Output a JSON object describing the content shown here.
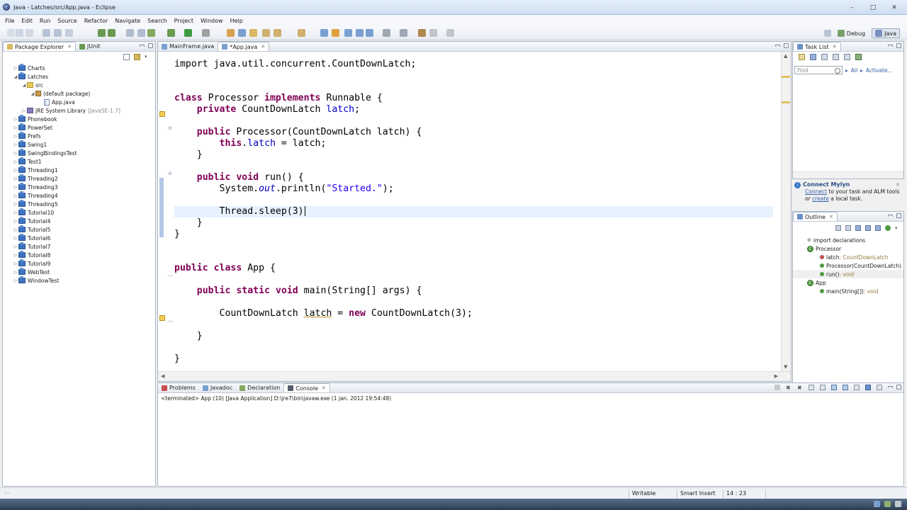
{
  "window": {
    "title": "Java - Latches/src/App.java - Eclipse"
  },
  "menu": [
    "File",
    "Edit",
    "Run",
    "Source",
    "Refactor",
    "Navigate",
    "Search",
    "Project",
    "Window",
    "Help"
  ],
  "perspectives": [
    {
      "label": "Debug",
      "active": false
    },
    {
      "label": "Java",
      "active": true
    }
  ],
  "package_explorer": {
    "tabs": [
      {
        "label": "Package Explorer",
        "active": true
      },
      {
        "label": "JUnit",
        "active": false
      }
    ],
    "rows": [
      {
        "label": "Charts",
        "indent": 0,
        "type": "project",
        "expanded": false
      },
      {
        "label": "Latches",
        "indent": 0,
        "type": "project",
        "expanded": true
      },
      {
        "label": "src",
        "indent": 1,
        "type": "src",
        "expanded": true
      },
      {
        "label": "(default package)",
        "indent": 2,
        "type": "package",
        "expanded": true
      },
      {
        "label": "App.java",
        "indent": 3,
        "type": "file",
        "expanded": null
      },
      {
        "label": "JRE System Library",
        "extra": "[JavaSE-1.7]",
        "indent": 1,
        "type": "lib",
        "expanded": false
      },
      {
        "label": "Phonebook",
        "indent": 0,
        "type": "project",
        "expanded": false
      },
      {
        "label": "PowerSet",
        "indent": 0,
        "type": "project",
        "expanded": false
      },
      {
        "label": "Prefs",
        "indent": 0,
        "type": "project",
        "expanded": false
      },
      {
        "label": "Swing1",
        "indent": 0,
        "type": "project",
        "expanded": false
      },
      {
        "label": "SwingBindingsTest",
        "indent": 0,
        "type": "project",
        "expanded": false
      },
      {
        "label": "Test1",
        "indent": 0,
        "type": "project",
        "expanded": false
      },
      {
        "label": "Threading1",
        "indent": 0,
        "type": "project",
        "expanded": false
      },
      {
        "label": "Threading2",
        "indent": 0,
        "type": "project",
        "expanded": false
      },
      {
        "label": "Threading3",
        "indent": 0,
        "type": "project",
        "expanded": false
      },
      {
        "label": "Threading4",
        "indent": 0,
        "type": "project",
        "expanded": false
      },
      {
        "label": "Threading5",
        "indent": 0,
        "type": "project",
        "expanded": false
      },
      {
        "label": "Tutorial10",
        "indent": 0,
        "type": "project",
        "expanded": false
      },
      {
        "label": "Tutorial4",
        "indent": 0,
        "type": "project",
        "expanded": false
      },
      {
        "label": "Tutorial5",
        "indent": 0,
        "type": "project",
        "expanded": false
      },
      {
        "label": "Tutorial6",
        "indent": 0,
        "type": "project",
        "expanded": false
      },
      {
        "label": "Tutorial7",
        "indent": 0,
        "type": "project",
        "expanded": false
      },
      {
        "label": "Tutorial8",
        "indent": 0,
        "type": "project",
        "expanded": false
      },
      {
        "label": "Tutorial9",
        "indent": 0,
        "type": "project",
        "expanded": false
      },
      {
        "label": "WebTest",
        "indent": 0,
        "type": "project",
        "expanded": false
      },
      {
        "label": "WindowTest",
        "indent": 0,
        "type": "project",
        "expanded": false
      }
    ]
  },
  "editor": {
    "tabs": [
      {
        "label": "MainFrame.java",
        "active": false
      },
      {
        "label": "*App.java",
        "active": true
      }
    ],
    "lines": [
      [
        [
          "t",
          "import java.util.concurrent.CountDownLatch;"
        ]
      ],
      [],
      [],
      [
        [
          "k",
          "class"
        ],
        [
          "t",
          " Processor "
        ],
        [
          "k",
          "implements"
        ],
        [
          "t",
          " Runnable {"
        ]
      ],
      [
        [
          "t",
          "    "
        ],
        [
          "k",
          "private"
        ],
        [
          "t",
          " CountDownLatch "
        ],
        [
          "f",
          "latch"
        ],
        [
          "t",
          ";"
        ]
      ],
      [],
      [
        [
          "t",
          "    "
        ],
        [
          "k",
          "public"
        ],
        [
          "t",
          " Processor(CountDownLatch latch) {"
        ]
      ],
      [
        [
          "t",
          "        "
        ],
        [
          "k",
          "this"
        ],
        [
          "t",
          "."
        ],
        [
          "f",
          "latch"
        ],
        [
          "t",
          " = latch;"
        ]
      ],
      [
        [
          "t",
          "    }"
        ]
      ],
      [],
      [
        [
          "t",
          "    "
        ],
        [
          "k",
          "public"
        ],
        [
          "t",
          " "
        ],
        [
          "k",
          "void"
        ],
        [
          "t",
          " run() {"
        ]
      ],
      [
        [
          "t",
          "        System."
        ],
        [
          "fi",
          "out"
        ],
        [
          "t",
          ".println("
        ],
        [
          "s",
          "\"Started.\""
        ],
        [
          "t",
          ");"
        ]
      ],
      [],
      [
        [
          "t",
          "        Thread.sleep(3)"
        ]
      ],
      [
        [
          "t",
          "    }"
        ]
      ],
      [
        [
          "t",
          "}"
        ]
      ],
      [],
      [],
      [
        [
          "k",
          "public"
        ],
        [
          "t",
          " "
        ],
        [
          "k",
          "class"
        ],
        [
          "t",
          " App {"
        ]
      ],
      [],
      [
        [
          "t",
          "    "
        ],
        [
          "k",
          "public"
        ],
        [
          "t",
          " "
        ],
        [
          "k",
          "static"
        ],
        [
          "t",
          " "
        ],
        [
          "k",
          "void"
        ],
        [
          "t",
          " main(String[] args) {"
        ]
      ],
      [],
      [
        [
          "t",
          "        CountDownLatch "
        ],
        [
          "u",
          "latch"
        ],
        [
          "t",
          " = "
        ],
        [
          "k",
          "new"
        ],
        [
          "t",
          " CountDownLatch(3);"
        ]
      ],
      [],
      [
        [
          "t",
          "    }"
        ]
      ],
      [],
      [
        [
          "t",
          "}"
        ]
      ]
    ],
    "current_line": 13
  },
  "task_list": {
    "tab": "Task List",
    "find_placeholder": "Find",
    "all_label": "All",
    "activate_label": "Activate..."
  },
  "mylyn": {
    "title": "Connect Mylyn",
    "connect": "Connect",
    "line1_rest": " to your task and ALM tools",
    "line2_pre": "or ",
    "create": "create",
    "line2_rest": " a local task."
  },
  "outline": {
    "tab": "Outline",
    "rows": [
      {
        "label": "import declarations",
        "indent": 1,
        "icon": "import"
      },
      {
        "label": "Processor",
        "indent": 1,
        "icon": "class"
      },
      {
        "label": "latch",
        "type": " : CountDownLatch",
        "indent": 2,
        "icon": "field"
      },
      {
        "label": "Processor(CountDownLatch)",
        "type": "",
        "indent": 2,
        "icon": "ctor"
      },
      {
        "label": "run()",
        "type": " : void",
        "indent": 2,
        "icon": "method",
        "selected": true
      },
      {
        "label": "App",
        "indent": 1,
        "icon": "class"
      },
      {
        "label": "main(String[])",
        "type": " : void",
        "indent": 2,
        "icon": "method"
      }
    ]
  },
  "bottom": {
    "tabs": [
      {
        "label": "Problems",
        "active": false
      },
      {
        "label": "Javadoc",
        "active": false
      },
      {
        "label": "Declaration",
        "active": false
      },
      {
        "label": "Console",
        "active": true
      }
    ],
    "console_info": "<terminated> App (10) [Java Application] D:\\jre7\\bin\\javaw.exe (1 jan. 2012 19:54:48)"
  },
  "status": {
    "writable": "Writable",
    "insert_mode": "Smart Insert",
    "position": "14 : 23"
  },
  "colors": {
    "keyword": "#7f0055",
    "field": "#0000c0",
    "string": "#2a00ff",
    "current_line": "#e8f2fe"
  }
}
